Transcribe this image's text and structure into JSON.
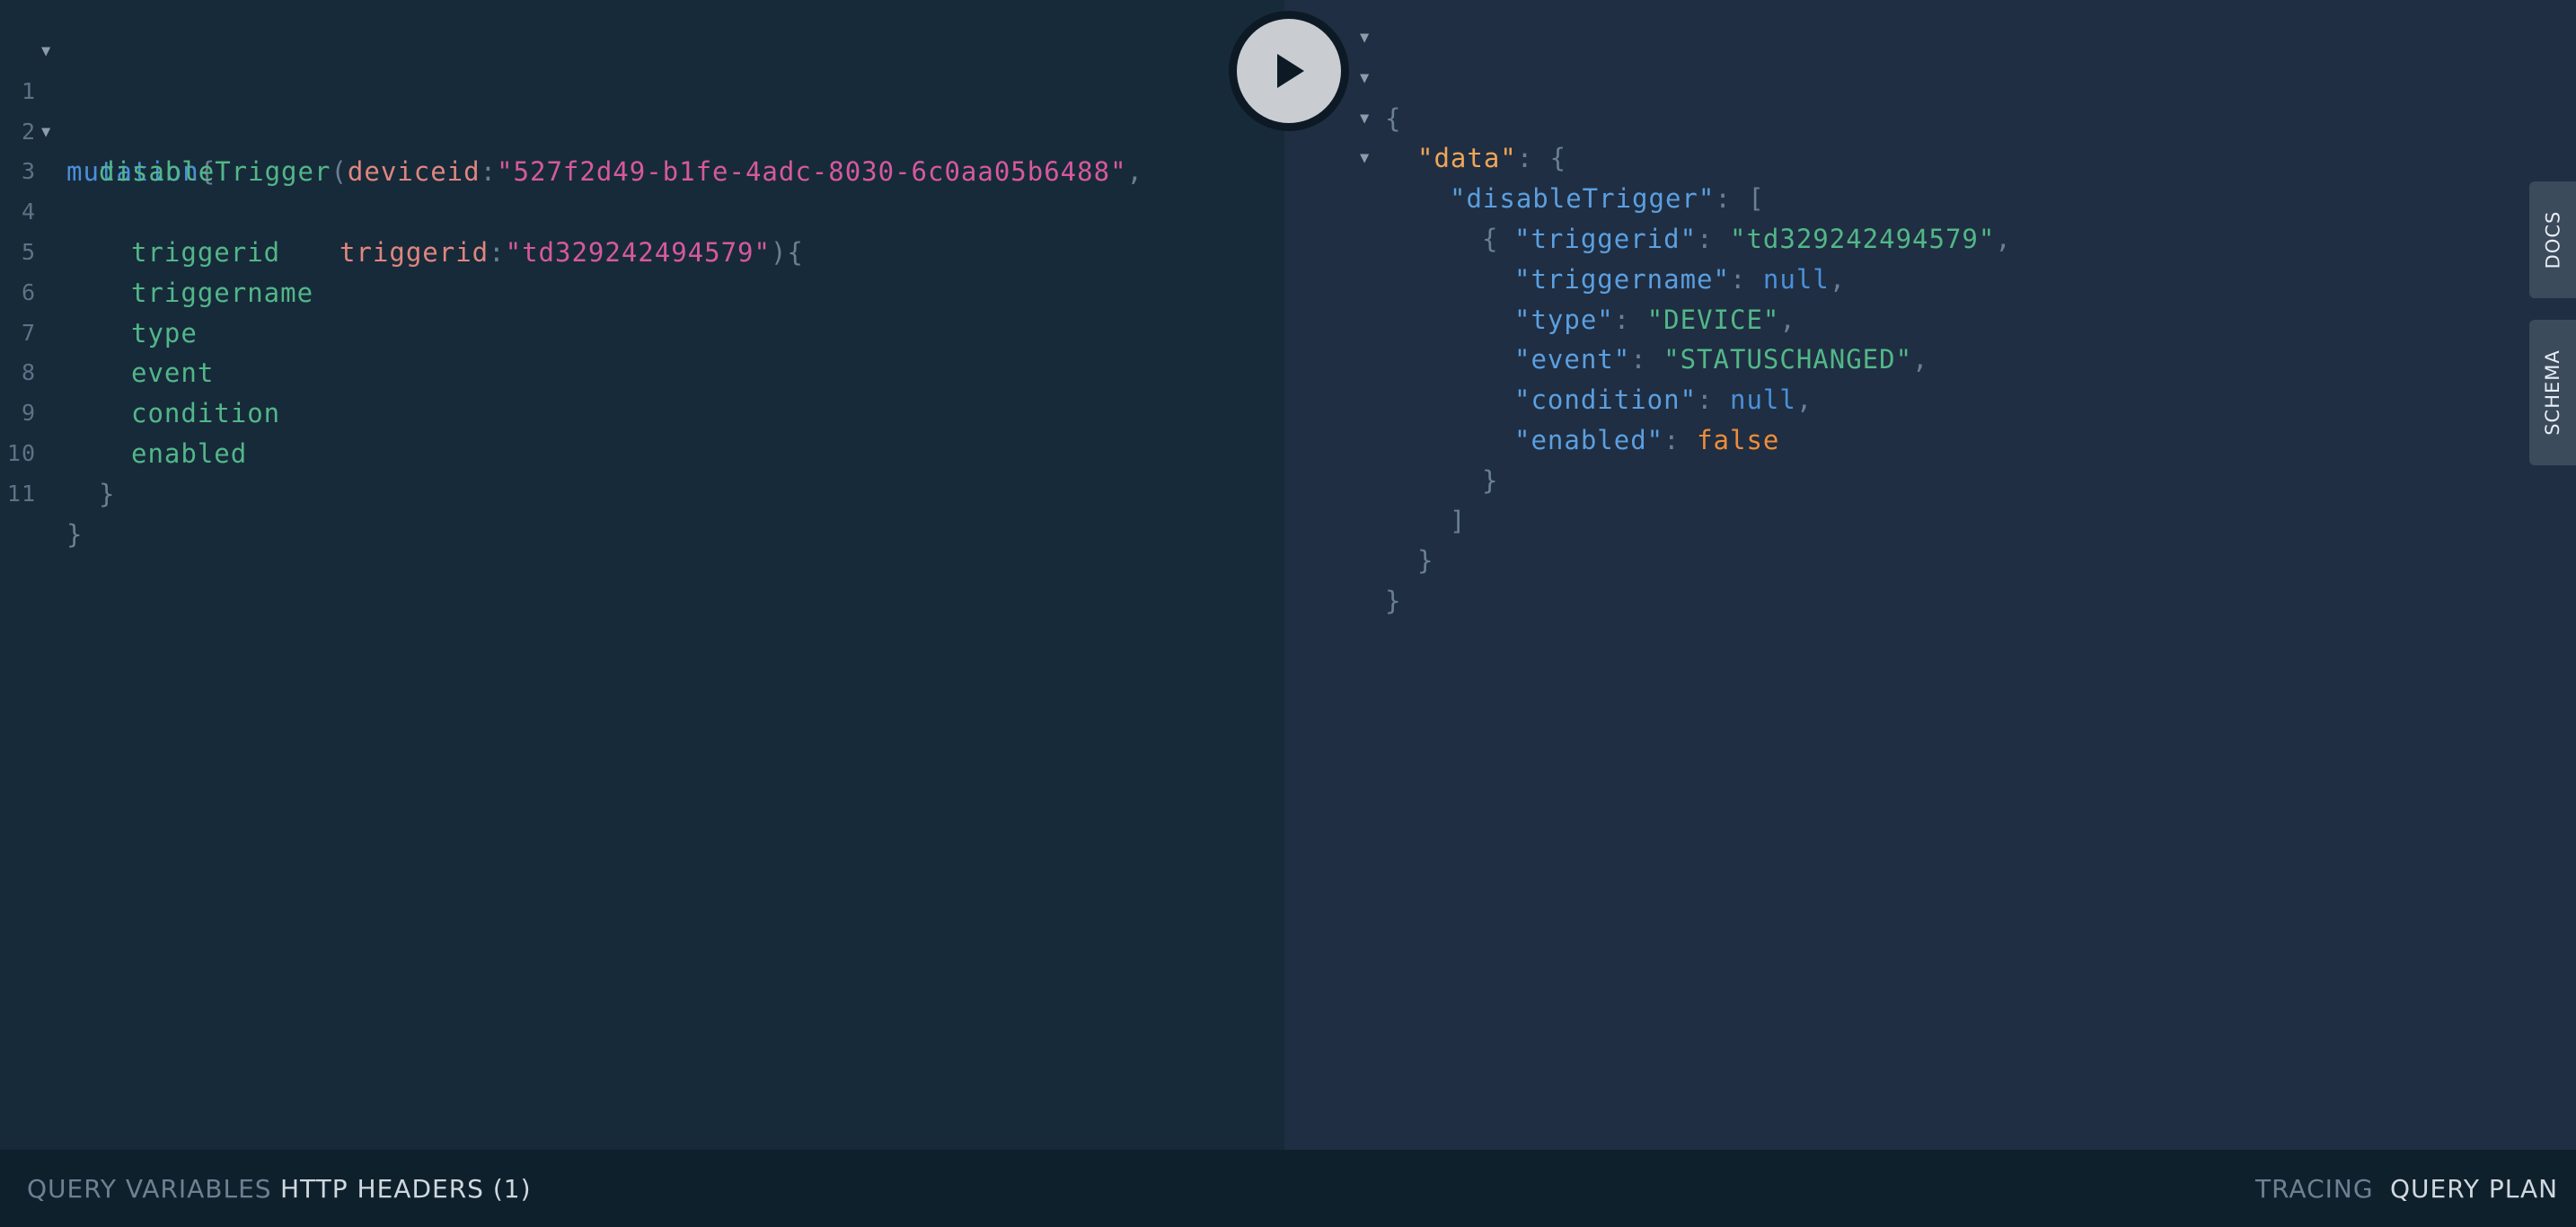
{
  "query": {
    "line_numbers": [
      "1",
      "2",
      "3",
      "4",
      "5",
      "6",
      "7",
      "8",
      "9",
      "10",
      "11"
    ],
    "keyword": "mutation",
    "brace_open": "{",
    "function": "disableTrigger",
    "paren_open": "(",
    "arg1_name": "deviceid",
    "colon": ":",
    "arg1_value": "\"527f2d49-b1fe-4adc-8030-6c0aa05b6488\"",
    "comma": ",",
    "arg2_name": "triggerid",
    "arg2_value": "\"td329242494579\"",
    "paren_close_brace": "){",
    "fields": [
      "triggerid",
      "triggername",
      "type",
      "event",
      "condition",
      "enabled"
    ],
    "brace_close": "}"
  },
  "result": {
    "open": "{",
    "data_key": "\"data\"",
    "data_after": ": {",
    "fn_key": "\"disableTrigger\"",
    "fn_after": ": [",
    "obj_open": "{",
    "rows": [
      {
        "key": "\"triggerid\"",
        "value": "\"td329242494579\"",
        "kind": "jstr",
        "end": ","
      },
      {
        "key": "\"triggername\"",
        "value": "null",
        "kind": "jnull",
        "end": ","
      },
      {
        "key": "\"type\"",
        "value": "\"DEVICE\"",
        "kind": "jstr",
        "end": ","
      },
      {
        "key": "\"event\"",
        "value": "\"STATUSCHANGED\"",
        "kind": "jstr",
        "end": ","
      },
      {
        "key": "\"condition\"",
        "value": "null",
        "kind": "jnull",
        "end": ","
      },
      {
        "key": "\"enabled\"",
        "value": "false",
        "kind": "jbool",
        "end": ""
      }
    ],
    "obj_close": "}",
    "arr_close": "]",
    "data_close": "}",
    "close": "}"
  },
  "side_tabs": {
    "docs": "DOCS",
    "schema": "SCHEMA"
  },
  "bottom_bar": {
    "query_variables": "QUERY VARIABLES",
    "http_headers": "HTTP HEADERS (1)",
    "tracing": "TRACING",
    "query_plan": "QUERY PLAN"
  },
  "icons": {
    "run": "play-icon",
    "fold": "triangle-down-icon"
  },
  "colors": {
    "editor_bg": "#172a3a",
    "result_bg": "#1f2e42",
    "keyword": "#4a90d9",
    "field": "#52b788",
    "argument": "#e0867e",
    "string": "#d6599d",
    "json_top_key": "#f0a556",
    "json_key": "#5b9fe0",
    "json_bool": "#ef8d3a"
  }
}
